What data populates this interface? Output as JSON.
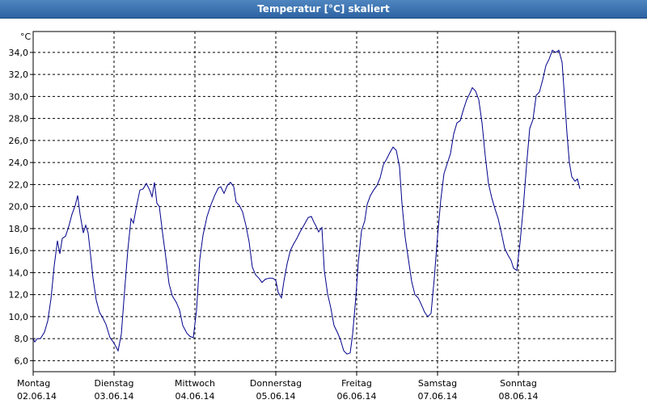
{
  "window": {
    "title": "Temperatur [°C] skaliert"
  },
  "chart_data": {
    "type": "line",
    "title": "Temperatur [°C] skaliert",
    "ylabel": "°C",
    "xlabel": "",
    "ylim": [
      5.0,
      35.9
    ],
    "y_ticks": [
      "6,0",
      "8,0",
      "10,0",
      "12,0",
      "14,0",
      "16,0",
      "18,0",
      "20,0",
      "22,0",
      "24,0",
      "26,0",
      "28,0",
      "30,0",
      "32,0",
      "34,0"
    ],
    "x_days": [
      {
        "day": "Montag",
        "date": "02.06.14"
      },
      {
        "day": "Dienstag",
        "date": "03.06.14"
      },
      {
        "day": "Mittwoch",
        "date": "04.06.14"
      },
      {
        "day": "Donnerstag",
        "date": "05.06.14"
      },
      {
        "day": "Freitag",
        "date": "06.06.14"
      },
      {
        "day": "Samstag",
        "date": "07.06.14"
      },
      {
        "day": "Sonntag",
        "date": "08.06.14"
      }
    ],
    "xlim_days": [
      0,
      7.2
    ],
    "grid": true,
    "line_color": "#00008b",
    "series": [
      {
        "values": [
          [
            0.0,
            8.0
          ],
          [
            0.02,
            7.7
          ],
          [
            0.05,
            8.0
          ],
          [
            0.09,
            8.0
          ],
          [
            0.14,
            8.6
          ],
          [
            0.18,
            9.6
          ],
          [
            0.22,
            11.6
          ],
          [
            0.26,
            14.6
          ],
          [
            0.3,
            16.9
          ],
          [
            0.33,
            15.7
          ],
          [
            0.36,
            17.1
          ],
          [
            0.4,
            17.3
          ],
          [
            0.44,
            18.2
          ],
          [
            0.48,
            19.3
          ],
          [
            0.52,
            20.1
          ],
          [
            0.55,
            21.0
          ],
          [
            0.58,
            19.3
          ],
          [
            0.62,
            17.6
          ],
          [
            0.65,
            18.3
          ],
          [
            0.68,
            17.6
          ],
          [
            0.71,
            15.6
          ],
          [
            0.74,
            13.5
          ],
          [
            0.78,
            11.5
          ],
          [
            0.82,
            10.4
          ],
          [
            0.86,
            9.9
          ],
          [
            0.9,
            9.3
          ],
          [
            0.95,
            8.1
          ],
          [
            1.0,
            7.6
          ],
          [
            1.05,
            6.9
          ],
          [
            1.09,
            8.4
          ],
          [
            1.13,
            12.3
          ],
          [
            1.17,
            16.0
          ],
          [
            1.21,
            18.9
          ],
          [
            1.24,
            18.5
          ],
          [
            1.28,
            20.1
          ],
          [
            1.32,
            21.5
          ],
          [
            1.36,
            21.6
          ],
          [
            1.4,
            22.1
          ],
          [
            1.44,
            21.5
          ],
          [
            1.47,
            20.9
          ],
          [
            1.5,
            22.2
          ],
          [
            1.53,
            20.3
          ],
          [
            1.56,
            20.0
          ],
          [
            1.6,
            17.6
          ],
          [
            1.64,
            15.4
          ],
          [
            1.68,
            13.0
          ],
          [
            1.72,
            11.9
          ],
          [
            1.77,
            11.3
          ],
          [
            1.81,
            10.6
          ],
          [
            1.85,
            9.2
          ],
          [
            1.9,
            8.5
          ],
          [
            1.94,
            8.2
          ],
          [
            1.98,
            8.1
          ],
          [
            2.02,
            10.6
          ],
          [
            2.06,
            15.2
          ],
          [
            2.1,
            17.4
          ],
          [
            2.15,
            19.1
          ],
          [
            2.2,
            20.2
          ],
          [
            2.25,
            21.1
          ],
          [
            2.29,
            21.7
          ],
          [
            2.32,
            21.8
          ],
          [
            2.36,
            21.2
          ],
          [
            2.4,
            21.9
          ],
          [
            2.44,
            22.2
          ],
          [
            2.48,
            21.8
          ],
          [
            2.51,
            20.4
          ],
          [
            2.55,
            20.1
          ],
          [
            2.59,
            19.5
          ],
          [
            2.63,
            18.3
          ],
          [
            2.67,
            16.8
          ],
          [
            2.71,
            14.5
          ],
          [
            2.75,
            13.8
          ],
          [
            2.79,
            13.5
          ],
          [
            2.83,
            13.1
          ],
          [
            2.87,
            13.4
          ],
          [
            2.92,
            13.5
          ],
          [
            2.96,
            13.5
          ],
          [
            3.0,
            13.3
          ],
          [
            3.03,
            12.2
          ],
          [
            3.07,
            11.7
          ],
          [
            3.1,
            13.2
          ],
          [
            3.14,
            14.8
          ],
          [
            3.18,
            16.0
          ],
          [
            3.22,
            16.6
          ],
          [
            3.26,
            17.1
          ],
          [
            3.3,
            17.7
          ],
          [
            3.34,
            18.2
          ],
          [
            3.37,
            18.6
          ],
          [
            3.4,
            19.0
          ],
          [
            3.44,
            19.1
          ],
          [
            3.47,
            18.6
          ],
          [
            3.5,
            18.2
          ],
          [
            3.53,
            17.7
          ],
          [
            3.57,
            18.1
          ],
          [
            3.6,
            14.2
          ],
          [
            3.64,
            12.1
          ],
          [
            3.68,
            10.8
          ],
          [
            3.72,
            9.2
          ],
          [
            3.76,
            8.6
          ],
          [
            3.8,
            7.9
          ],
          [
            3.84,
            6.9
          ],
          [
            3.88,
            6.6
          ],
          [
            3.92,
            6.7
          ],
          [
            3.95,
            8.4
          ],
          [
            3.99,
            11.8
          ],
          [
            4.02,
            14.9
          ],
          [
            4.06,
            17.8
          ],
          [
            4.1,
            18.7
          ],
          [
            4.13,
            20.2
          ],
          [
            4.17,
            21.0
          ],
          [
            4.21,
            21.5
          ],
          [
            4.25,
            21.9
          ],
          [
            4.29,
            22.6
          ],
          [
            4.33,
            23.8
          ],
          [
            4.37,
            24.3
          ],
          [
            4.41,
            24.9
          ],
          [
            4.45,
            25.4
          ],
          [
            4.49,
            25.1
          ],
          [
            4.53,
            23.6
          ],
          [
            4.56,
            20.3
          ],
          [
            4.6,
            17.2
          ],
          [
            4.64,
            15.2
          ],
          [
            4.68,
            13.2
          ],
          [
            4.72,
            12.0
          ],
          [
            4.76,
            11.7
          ],
          [
            4.8,
            11.1
          ],
          [
            4.84,
            10.4
          ],
          [
            4.88,
            10.0
          ],
          [
            4.92,
            10.3
          ],
          [
            4.96,
            13.5
          ],
          [
            5.0,
            17.3
          ],
          [
            5.04,
            20.6
          ],
          [
            5.08,
            23.0
          ],
          [
            5.12,
            23.9
          ],
          [
            5.16,
            24.8
          ],
          [
            5.2,
            26.6
          ],
          [
            5.24,
            27.6
          ],
          [
            5.28,
            27.8
          ],
          [
            5.32,
            28.8
          ],
          [
            5.36,
            29.7
          ],
          [
            5.4,
            30.3
          ],
          [
            5.43,
            30.8
          ],
          [
            5.47,
            30.5
          ],
          [
            5.51,
            29.7
          ],
          [
            5.55,
            27.6
          ],
          [
            5.59,
            24.6
          ],
          [
            5.63,
            22.1
          ],
          [
            5.67,
            20.8
          ],
          [
            5.71,
            19.8
          ],
          [
            5.75,
            18.9
          ],
          [
            5.79,
            17.6
          ],
          [
            5.83,
            16.2
          ],
          [
            5.87,
            15.6
          ],
          [
            5.91,
            15.1
          ],
          [
            5.94,
            14.4
          ],
          [
            5.98,
            14.2
          ],
          [
            6.02,
            16.7
          ],
          [
            6.06,
            19.9
          ],
          [
            6.1,
            23.7
          ],
          [
            6.14,
            27.1
          ],
          [
            6.18,
            27.9
          ],
          [
            6.22,
            30.1
          ],
          [
            6.26,
            30.4
          ],
          [
            6.3,
            31.5
          ],
          [
            6.34,
            32.8
          ],
          [
            6.38,
            33.4
          ],
          [
            6.42,
            34.2
          ],
          [
            6.46,
            34.0
          ],
          [
            6.5,
            34.2
          ],
          [
            6.54,
            33.1
          ],
          [
            6.57,
            30.0
          ],
          [
            6.6,
            26.7
          ],
          [
            6.63,
            24.0
          ],
          [
            6.66,
            22.7
          ],
          [
            6.7,
            22.3
          ],
          [
            6.73,
            22.5
          ],
          [
            6.76,
            21.6
          ]
        ]
      }
    ]
  }
}
